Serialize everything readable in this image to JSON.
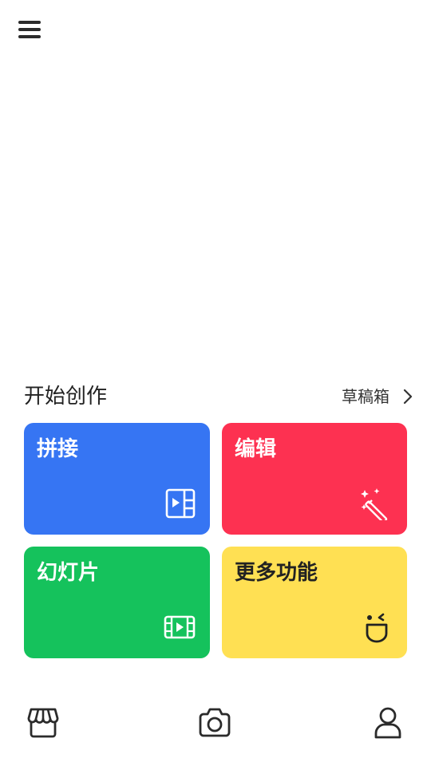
{
  "header": {
    "menu_icon": "hamburger-menu-icon"
  },
  "section": {
    "title": "开始创作",
    "drafts_label": "草稿箱",
    "drafts_icon": "chevron-right-icon"
  },
  "cards": {
    "collage": {
      "label": "拼接",
      "icon": "collage-layout-icon",
      "color": "#3675f3"
    },
    "edit": {
      "label": "编辑",
      "icon": "magic-wand-icon",
      "color": "#fd3151"
    },
    "slideshow": {
      "label": "幻灯片",
      "icon": "film-strip-icon",
      "color": "#15c25c"
    },
    "more": {
      "label": "更多功能",
      "icon": "smiley-face-icon",
      "color": "#ffe053"
    }
  },
  "bottom_nav": {
    "items": [
      {
        "icon": "store-icon"
      },
      {
        "icon": "camera-icon"
      },
      {
        "icon": "profile-icon"
      }
    ]
  }
}
